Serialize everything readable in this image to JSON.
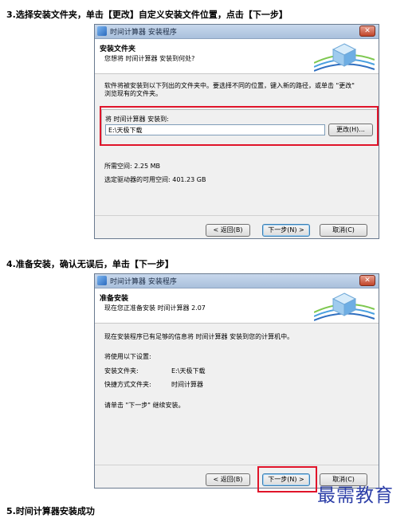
{
  "step3": {
    "caption": "3.选择安装文件夹，单击【更改】自定义安装文件位置，点击【下一步】",
    "dialog": {
      "title": "时间计算器 安装程序",
      "header_title": "安装文件夹",
      "header_subtitle": "您想将 时间计算器 安装到何处?",
      "instruction_line1": "软件将被安装到以下列出的文件夹中。要选择不同的位置，键入新的路径，或单击 \"更改\"",
      "instruction_line2": "浏览现有的文件夹。",
      "install_to_label": "将 时间计算器 安装到:",
      "path_value": "E:\\天极下载",
      "change_button": "更改(H)...",
      "required_space_label": "所需空间: 2.25 MB",
      "available_space_label": "选定驱动器的可用空间: 401.23 GB",
      "back_button": "< 返回(B)",
      "next_button": "下一步(N) >",
      "cancel_button": "取消(C)"
    }
  },
  "step4": {
    "caption": "4.准备安装，确认无误后，单击【下一步】",
    "dialog": {
      "title": "时间计算器 安装程序",
      "header_title": "准备安装",
      "header_subtitle": "现在您正准备安装 时间计算器 2.07",
      "ready_text": "现在安装程序已有足够的信息将 时间计算器 安装到您的计算机中。",
      "settings_label": "将使用以下设置:",
      "install_folder_label": "安装文件夹:",
      "install_folder_value": "E:\\天极下载",
      "shortcut_folder_label": "快捷方式文件夹:",
      "shortcut_folder_value": "时间计算器",
      "continue_text": "请单击 \"下一步\" 继续安装。",
      "back_button": "< 返回(B)",
      "next_button": "下一步(N) >",
      "cancel_button": "取消(C)"
    }
  },
  "step5": {
    "caption": "5.时间计算器安装成功"
  },
  "watermark": "最需教育",
  "colors": {
    "highlight": "#e0142a",
    "watermark": "#2d3fa8",
    "titlebar": "#b9cde6"
  }
}
